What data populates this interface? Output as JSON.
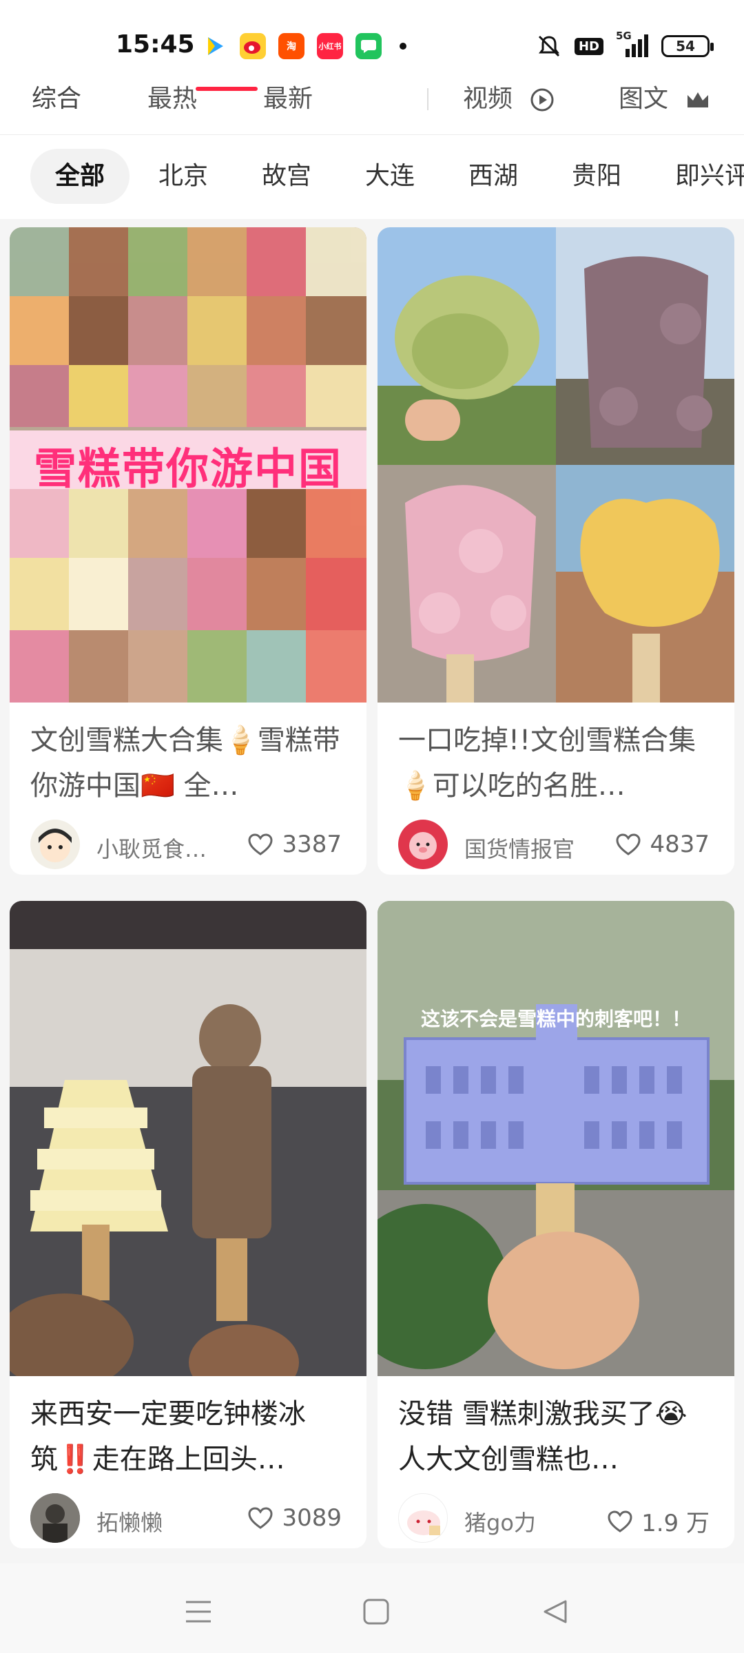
{
  "status_bar": {
    "time": "15:45",
    "apps": [
      {
        "icon": "play-icon",
        "color": "#2aa4ff"
      },
      {
        "icon": "weibo-icon",
        "color": "#ff8200"
      },
      {
        "icon": "taobao-icon",
        "color": "#ff5000",
        "label": "淘"
      },
      {
        "icon": "xiaohongshu-icon",
        "color": "#ff2442",
        "label": "小红书"
      },
      {
        "icon": "message-icon",
        "color": "#21c45d"
      }
    ],
    "hd": "HD",
    "network": "5G",
    "battery": "54"
  },
  "top_tabs": [
    {
      "label": "综合"
    },
    {
      "label": "最热"
    },
    {
      "label": "最新"
    },
    {
      "label": "视频"
    },
    {
      "label": "图文"
    }
  ],
  "chips": [
    "全部",
    "北京",
    "故宫",
    "大连",
    "西湖",
    "贵阳",
    "即兴评"
  ],
  "feed": [
    {
      "title": "文创雪糕大合集🍦雪糕带你游中国🇨🇳 全…",
      "image_text": "雪糕带你游中国",
      "author": "小耿觅食…",
      "likes": "3387"
    },
    {
      "title": "一口吃掉!!文创雪糕合集🍦可以吃的名胜…",
      "author": "国货情报官",
      "likes": "4837"
    },
    {
      "title": "来西安一定要吃钟楼冰筑‼️走在路上回头…",
      "author": "拓懒懒",
      "likes": "3089"
    },
    {
      "title": "没错 雪糕刺激我买了😭 人大文创雪糕也…",
      "image_text": "这该不会是雪糕中的刺客吧！！",
      "author": "猪go力",
      "likes": "1.9 万"
    }
  ],
  "colors": {
    "accent": "#ff2442",
    "background": "#f5f5f5"
  }
}
